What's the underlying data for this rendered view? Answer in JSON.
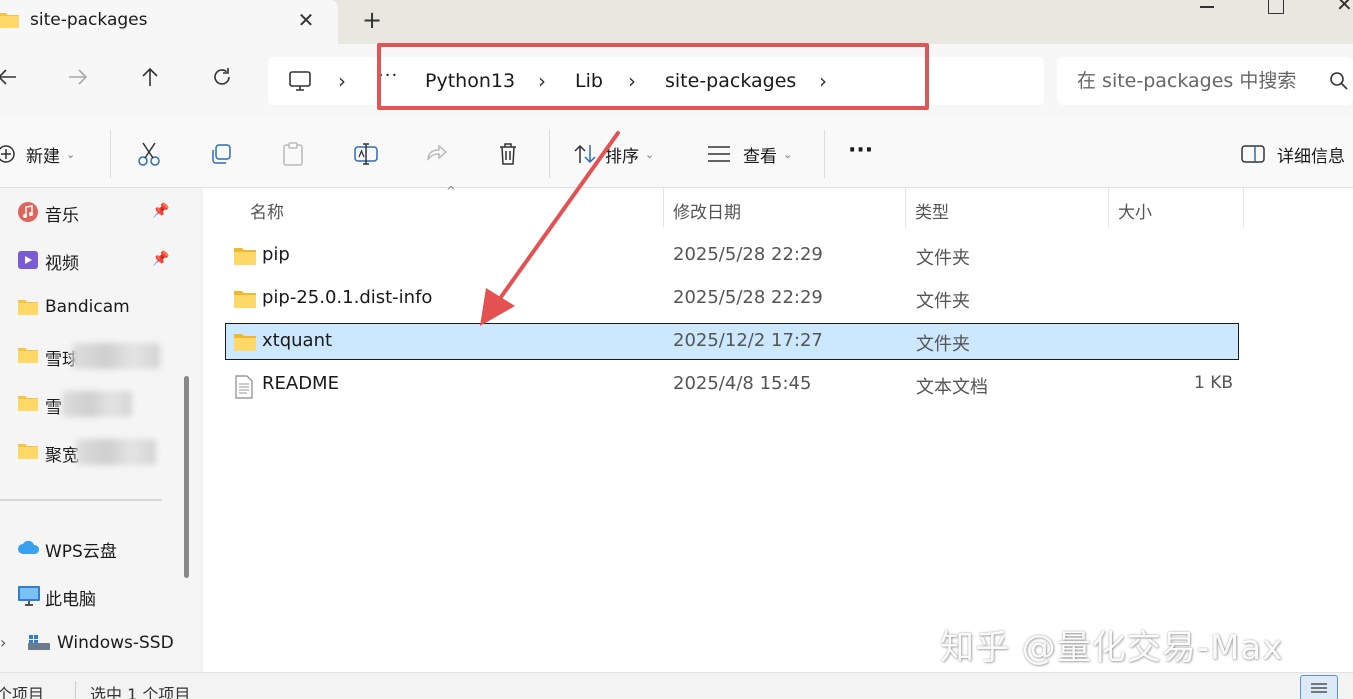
{
  "window": {
    "tab_title": "site-packages",
    "new_tab": "+",
    "close_tab": "✕"
  },
  "address": {
    "more": "···",
    "crumbs": [
      "Python13",
      "Lib",
      "site-packages"
    ],
    "search_placeholder": "在 site-packages 中搜索"
  },
  "toolbar": {
    "new_label": "新建",
    "sort_label": "排序",
    "view_label": "查看",
    "more_label": "···",
    "details_label": "详细信息"
  },
  "sidebar": {
    "items": [
      {
        "label": "音乐",
        "icon": "music-icon",
        "pinned": true
      },
      {
        "label": "视频",
        "icon": "video-icon",
        "pinned": true
      },
      {
        "label": "Bandicam",
        "icon": "folder-icon"
      },
      {
        "label": "雪球",
        "icon": "folder-icon"
      },
      {
        "label": "雪",
        "icon": "folder-icon"
      },
      {
        "label": "聚宽",
        "icon": "folder-icon"
      },
      {
        "label": "WPS云盘",
        "icon": "cloud-icon"
      },
      {
        "label": "此电脑",
        "icon": "computer-icon"
      },
      {
        "label": "Windows-SSD",
        "icon": "drive-icon"
      }
    ]
  },
  "columns": {
    "name": "名称",
    "date": "修改日期",
    "type": "类型",
    "size": "大小"
  },
  "files": [
    {
      "name": "pip",
      "date": "2025/5/28 22:29",
      "type": "文件夹",
      "size": "",
      "icon": "folder-icon"
    },
    {
      "name": "pip-25.0.1.dist-info",
      "date": "2025/5/28 22:29",
      "type": "文件夹",
      "size": "",
      "icon": "folder-icon"
    },
    {
      "name": "xtquant",
      "date": "2025/12/2 17:27",
      "type": "文件夹",
      "size": "",
      "icon": "folder-icon",
      "selected": true
    },
    {
      "name": "README",
      "date": "2025/4/8 15:45",
      "type": "文本文档",
      "size": "1 KB",
      "icon": "text-file-icon"
    }
  ],
  "status": {
    "count": "个项目",
    "selected": "选中 1 个项目"
  },
  "watermark": "知乎 @量化交易-Max",
  "colors": {
    "selection": "#cce8ff",
    "highlight": "#e05555",
    "folder": "#f6c445"
  }
}
